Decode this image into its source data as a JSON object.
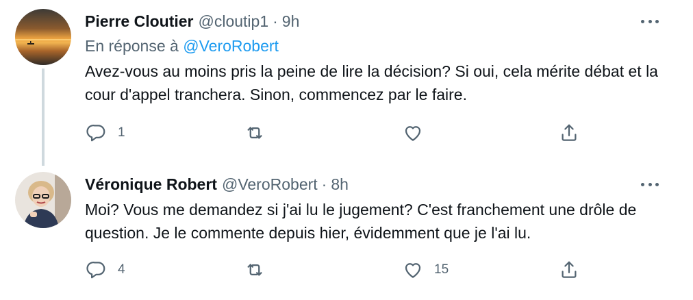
{
  "tweets": [
    {
      "display_name": "Pierre Cloutier",
      "handle": "@cloutip1",
      "separator": "·",
      "time": "9h",
      "reply_prefix": "En réponse à",
      "reply_mention": "@VeroRobert",
      "text": "Avez-vous au moins pris la peine de lire la décision? Si oui, cela mérite débat et la cour d'appel tranchera. Sinon, commencez par le faire.",
      "replies": "1",
      "retweets": "",
      "likes": ""
    },
    {
      "display_name": "Véronique Robert",
      "handle": "@VeroRobert",
      "separator": "·",
      "time": "8h",
      "text": "Moi? Vous me demandez si j'ai lu le jugement? C'est franchement une drôle de question. Je le commente depuis hier, évidemment que je l'ai lu.",
      "replies": "4",
      "retweets": "",
      "likes": "15"
    }
  ],
  "icons": {
    "reply": "reply-icon",
    "retweet": "retweet-icon",
    "like": "heart-icon",
    "share": "share-icon",
    "more": "more-options-icon"
  },
  "colors": {
    "text": "#0f1419",
    "secondary": "#536471",
    "link": "#1d9bf0",
    "thread_line": "#cfd9de"
  }
}
